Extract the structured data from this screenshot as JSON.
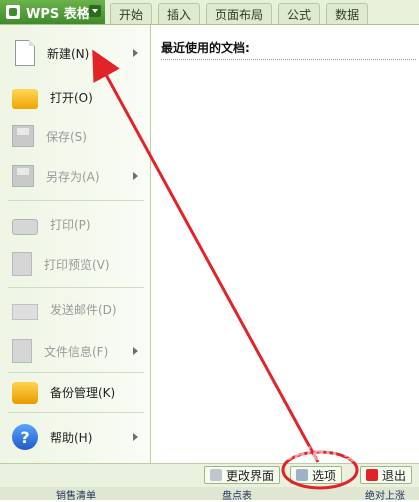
{
  "app": {
    "label": "WPS 表格",
    "tabs": [
      "开始",
      "插入",
      "页面布局",
      "公式",
      "数据"
    ]
  },
  "menu": {
    "items": [
      {
        "label": "新建(N)",
        "icon": "new-document-icon",
        "enabled": true,
        "submenu": true
      },
      {
        "label": "打开(O)",
        "icon": "folder-open-icon",
        "enabled": true,
        "submenu": false
      },
      {
        "label": "保存(S)",
        "icon": "save-disk-icon",
        "enabled": false,
        "submenu": false
      },
      {
        "label": "另存为(A)",
        "icon": "save-as-icon",
        "enabled": false,
        "submenu": true
      },
      {
        "label": "打印(P)",
        "icon": "printer-icon",
        "enabled": false,
        "submenu": false
      },
      {
        "label": "打印预览(V)",
        "icon": "print-preview-icon",
        "enabled": false,
        "submenu": false
      },
      {
        "label": "发送邮件(D)",
        "icon": "mail-icon",
        "enabled": false,
        "submenu": false
      },
      {
        "label": "文件信息(F)",
        "icon": "file-info-icon",
        "enabled": false,
        "submenu": true
      },
      {
        "label": "备份管理(K)",
        "icon": "backup-icon",
        "enabled": true,
        "submenu": false
      },
      {
        "label": "帮助(H)",
        "icon": "help-icon",
        "enabled": true,
        "submenu": true
      }
    ]
  },
  "recent": {
    "title": "最近使用的文档:"
  },
  "bottom": {
    "change_ui": "更改界面",
    "options": "选项",
    "exit": "退出"
  },
  "sheet_strip": [
    "销售清单",
    "盘点表",
    "绝对上涨"
  ],
  "watermark": "Baidu 经验",
  "colors": {
    "accent": "#3f8a2b",
    "arrow": "#e0242a"
  }
}
